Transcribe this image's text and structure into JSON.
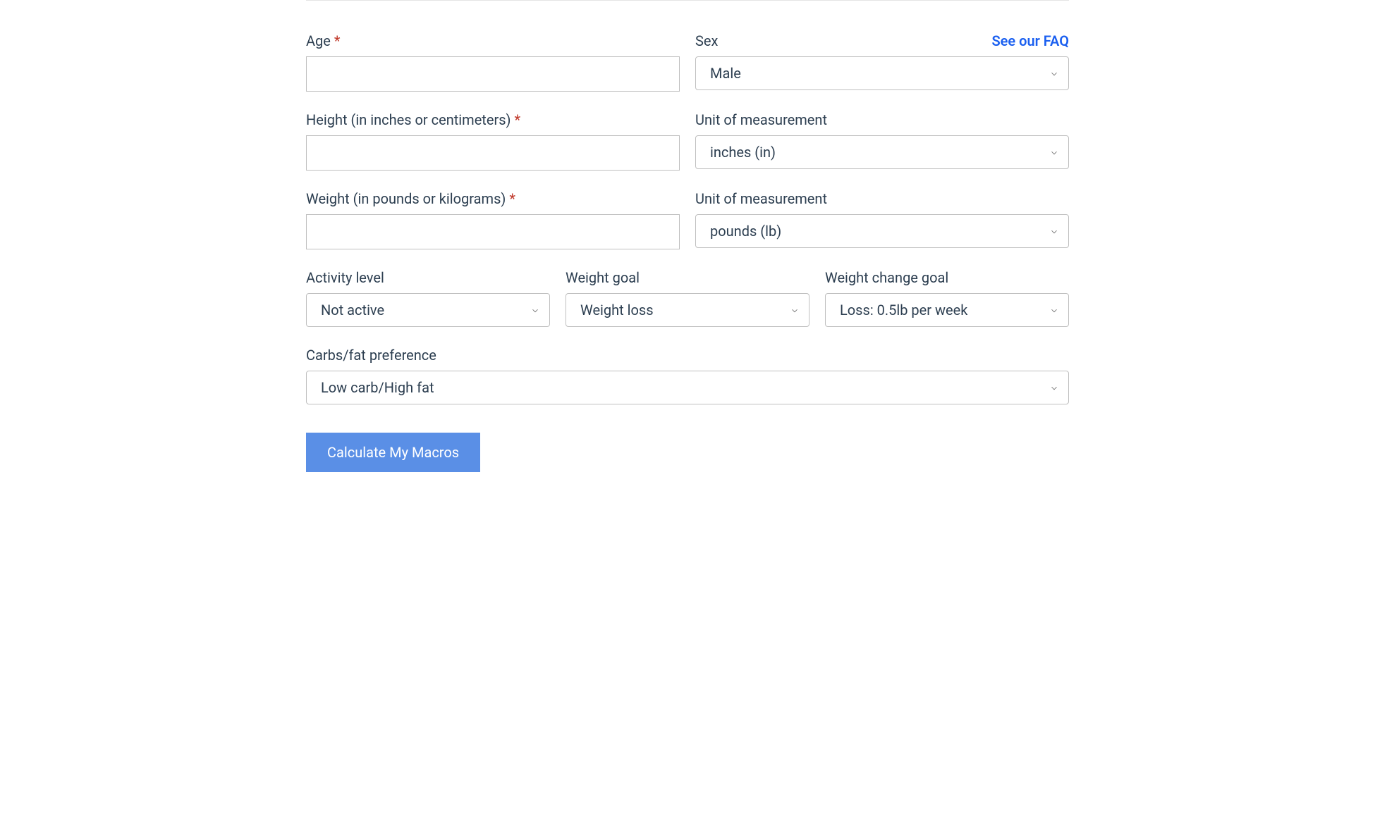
{
  "fields": {
    "age": {
      "label": "Age",
      "required": true,
      "value": ""
    },
    "sex": {
      "label": "Sex",
      "selected": "Male"
    },
    "height": {
      "label": "Height (in inches or centimeters)",
      "required": true,
      "value": ""
    },
    "heightUnit": {
      "label": "Unit of measurement",
      "selected": "inches (in)"
    },
    "weight": {
      "label": "Weight (in pounds or kilograms)",
      "required": true,
      "value": ""
    },
    "weightUnit": {
      "label": "Unit of measurement",
      "selected": "pounds (lb)"
    },
    "activityLevel": {
      "label": "Activity level",
      "selected": "Not active"
    },
    "weightGoal": {
      "label": "Weight goal",
      "selected": "Weight loss"
    },
    "weightChangeGoal": {
      "label": "Weight change goal",
      "selected": "Loss: 0.5lb per week"
    },
    "carbsFat": {
      "label": "Carbs/fat preference",
      "selected": "Low carb/High fat"
    }
  },
  "faqLink": "See our FAQ",
  "submitLabel": "Calculate My Macros",
  "requiredMark": "*"
}
